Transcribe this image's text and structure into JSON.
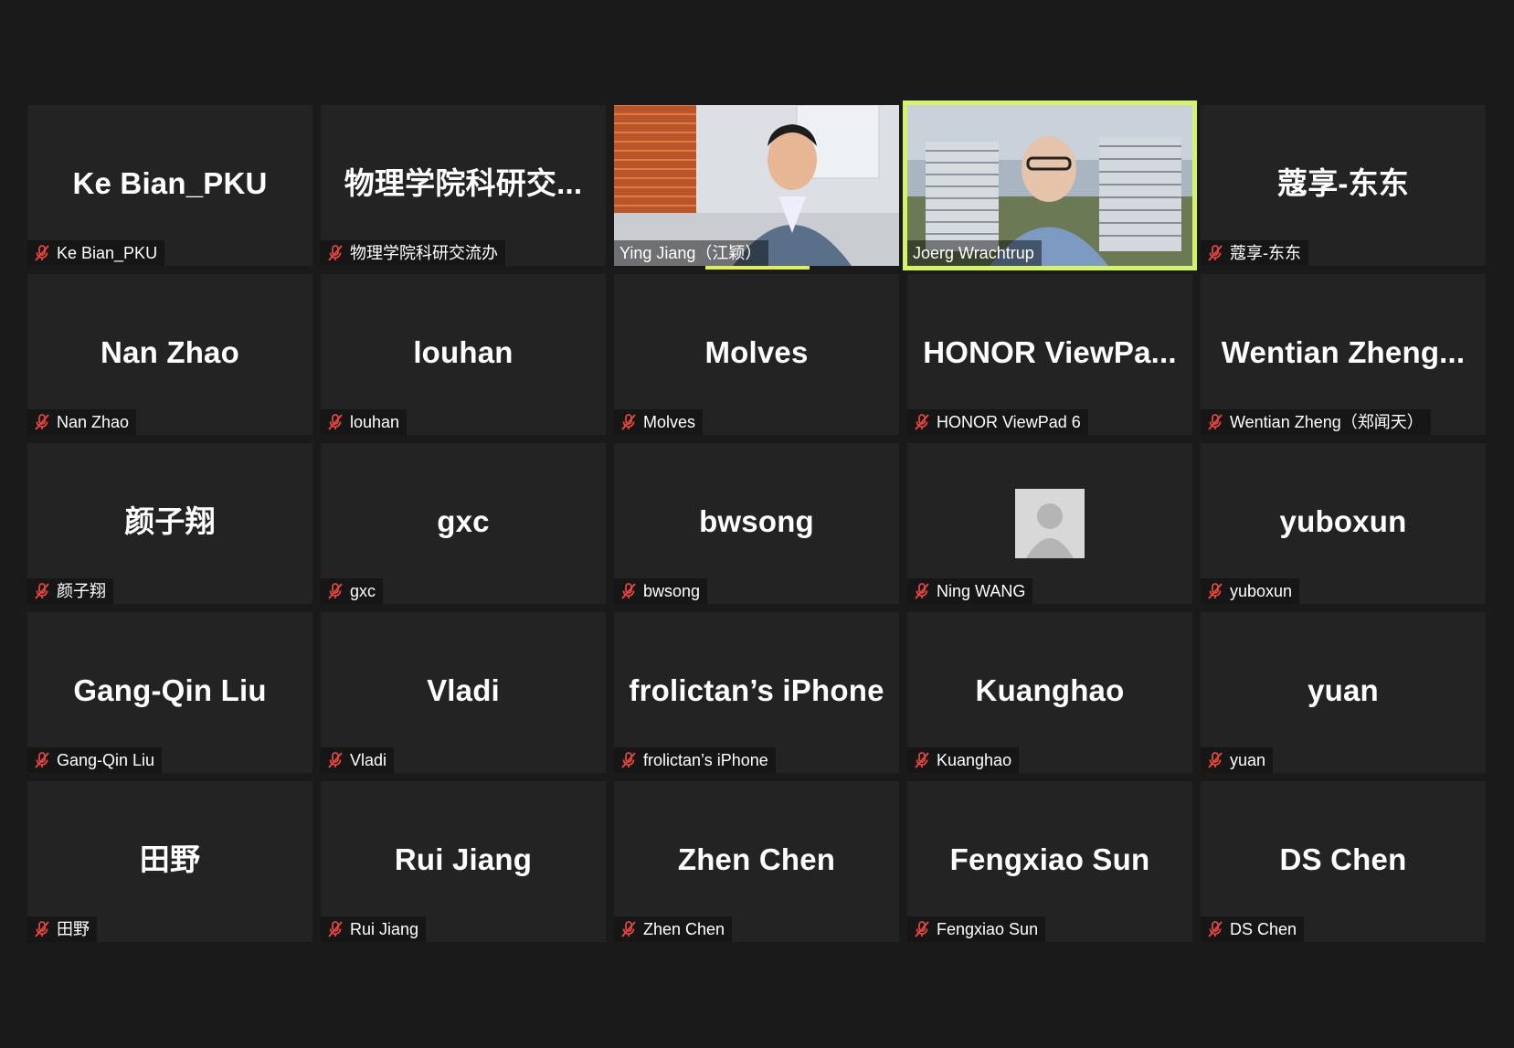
{
  "participants": [
    {
      "display": "Ke Bian_PKU",
      "label": "Ke Bian_PKU",
      "muted": true,
      "video": false
    },
    {
      "display": "物理学院科研交...",
      "label": "物理学院科研交流办",
      "muted": true,
      "video": false
    },
    {
      "display": "",
      "label": "Ying Jiang（江颖）",
      "muted": false,
      "video": true
    },
    {
      "display": "",
      "label": "Joerg Wrachtrup",
      "muted": false,
      "video": true,
      "active": true
    },
    {
      "display": "蔻享-东东",
      "label": "蔻享-东东",
      "muted": true,
      "video": false
    },
    {
      "display": "Nan Zhao",
      "label": "Nan Zhao",
      "muted": true,
      "video": false
    },
    {
      "display": "louhan",
      "label": "louhan",
      "muted": true,
      "video": false
    },
    {
      "display": "Molves",
      "label": "Molves",
      "muted": true,
      "video": false
    },
    {
      "display": "HONOR  ViewPa...",
      "label": "HONOR ViewPad 6",
      "muted": true,
      "video": false
    },
    {
      "display": "Wentian  Zheng...",
      "label": "Wentian Zheng（郑闻天）",
      "muted": true,
      "video": false
    },
    {
      "display": "颜子翔",
      "label": "颜子翔",
      "muted": true,
      "video": false
    },
    {
      "display": "gxc",
      "label": "gxc",
      "muted": true,
      "video": false
    },
    {
      "display": "bwsong",
      "label": "bwsong",
      "muted": true,
      "video": false
    },
    {
      "display": "",
      "label": "Ning WANG",
      "muted": true,
      "video": false,
      "avatar": true
    },
    {
      "display": "yuboxun",
      "label": "yuboxun",
      "muted": true,
      "video": false
    },
    {
      "display": "Gang-Qin Liu",
      "label": "Gang-Qin Liu",
      "muted": true,
      "video": false
    },
    {
      "display": "Vladi",
      "label": "Vladi",
      "muted": true,
      "video": false
    },
    {
      "display": "frolictan’s iPhone",
      "label": "frolictan’s iPhone",
      "muted": true,
      "video": false
    },
    {
      "display": "Kuanghao",
      "label": "Kuanghao",
      "muted": true,
      "video": false
    },
    {
      "display": "yuan",
      "label": "yuan",
      "muted": true,
      "video": false
    },
    {
      "display": "田野",
      "label": "田野",
      "muted": true,
      "video": false
    },
    {
      "display": "Rui Jiang",
      "label": "Rui Jiang",
      "muted": true,
      "video": false
    },
    {
      "display": "Zhen Chen",
      "label": "Zhen Chen",
      "muted": true,
      "video": false
    },
    {
      "display": "Fengxiao Sun",
      "label": "Fengxiao Sun",
      "muted": true,
      "video": false
    },
    {
      "display": "DS Chen",
      "label": "DS Chen",
      "muted": true,
      "video": false
    }
  ],
  "icons": {
    "muted_mic": "mic-off-icon",
    "avatar": "default-avatar-icon"
  },
  "colors": {
    "background": "#1a1a1a",
    "tile": "#232323",
    "active_speaker": "#d4f26a",
    "muted_icon": "#e0463f"
  }
}
